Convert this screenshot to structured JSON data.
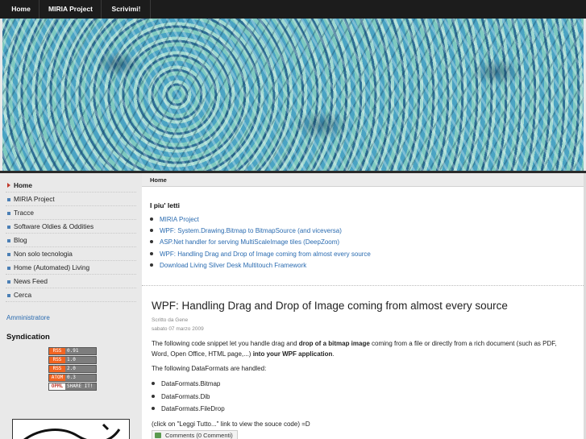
{
  "nav": {
    "tabs": [
      {
        "label": "Home"
      },
      {
        "label": "MIRIA Project"
      },
      {
        "label": "Scrivimi!"
      }
    ]
  },
  "sidebar": {
    "items": [
      {
        "label": "Home",
        "active": true
      },
      {
        "label": "MIRIA Project"
      },
      {
        "label": "Tracce"
      },
      {
        "label": "Software Oldies & Oddities"
      },
      {
        "label": "Blog"
      },
      {
        "label": "Non solo tecnologia"
      },
      {
        "label": "Home (Automated) Living"
      },
      {
        "label": "News Feed"
      },
      {
        "label": "Cerca"
      }
    ],
    "admin_link": "Amministratore",
    "syndication_title": "Syndication",
    "badges": [
      {
        "key": "RSS",
        "value": "0.91"
      },
      {
        "key": "RSS",
        "value": "1.0"
      },
      {
        "key": "RSS",
        "value": "2.0"
      },
      {
        "key": "ATOM",
        "value": "0.3"
      },
      {
        "key": "OPML",
        "value": "SHARE IT!"
      }
    ]
  },
  "main": {
    "breadcrumb": "Home",
    "popular_title": "I piu' letti",
    "popular_items": [
      "MIRIA Project",
      "WPF: System.Drawing.Bitmap to BitmapSource (and viceversa)",
      "ASP.Net handler for serving MultiScaleImage tiles (DeepZoom)",
      "WPF: Handling Drag and Drop of Image coming from almost every source",
      "Download Living Silver Desk Multitouch Framework"
    ],
    "post": {
      "title": "WPF: Handling Drag and Drop of Image coming from almost every source",
      "author": "Scritto da Gene",
      "date": "sabato 07 marzo 2009",
      "intro_1": "The following code snippet let you handle drag and ",
      "intro_bold_1": "drop of a bitmap image",
      "intro_2": " coming from a file or directly from a rich document (such as PDF, Word, Open Office, HTML page,...) ",
      "intro_bold_2": "into your WPF application",
      "intro_3": ".",
      "handled_line": "The following DataFormats are handled:",
      "dataformats": [
        "DataFormats.Bitmap",
        "DataFormats.Dib",
        "DataFormats.FileDrop"
      ],
      "readmore": "(click on \"Leggi Tutto...\" link to view the souce code) =D",
      "comments": "Comments (0 Commenti)"
    }
  },
  "colors": {
    "nav_bg": "#1c1c1c",
    "link": "#2a6bb0",
    "bullet": "#4b7fb5",
    "active_arrow": "#c0392b",
    "rss_orange": "#f26522"
  }
}
